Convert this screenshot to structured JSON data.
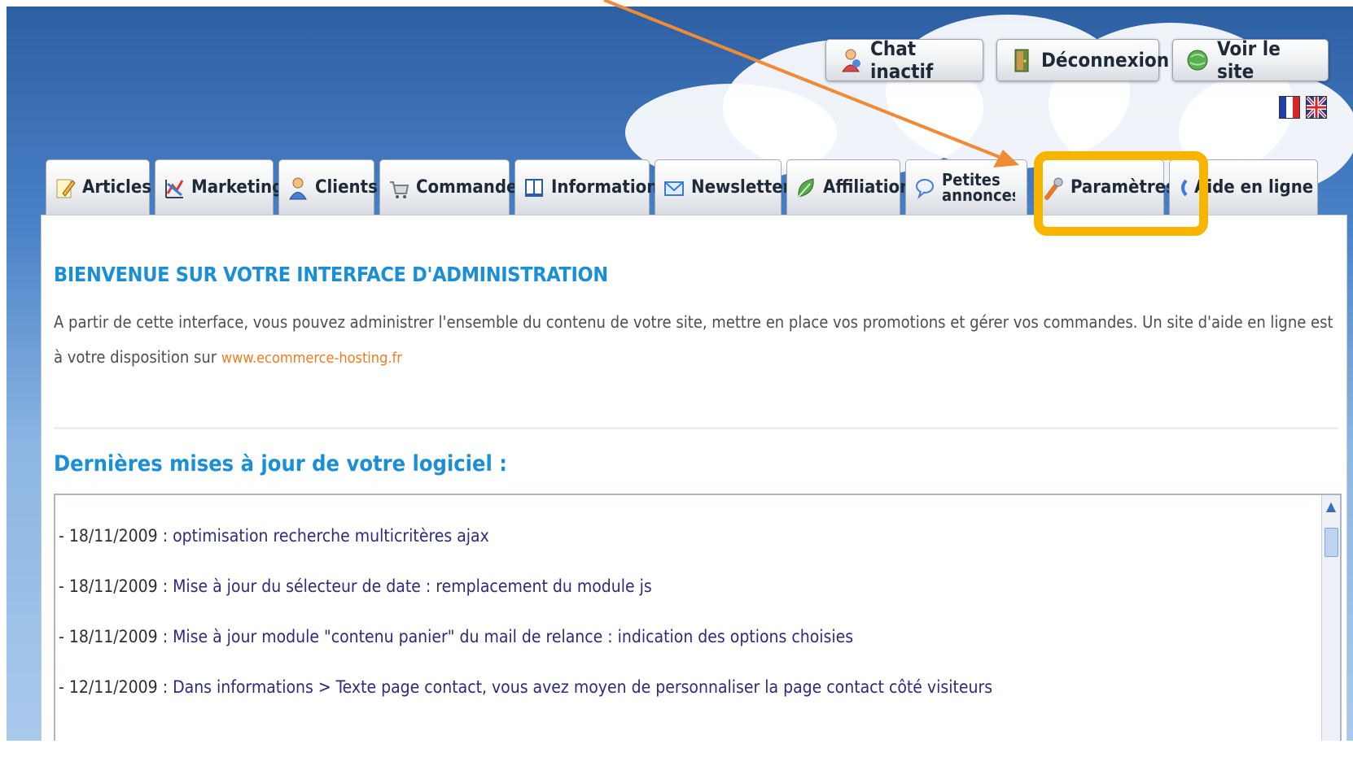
{
  "top_buttons": {
    "chat": "Chat inactif",
    "logout": "Déconnexion",
    "view_site": "Voir le site"
  },
  "tabs": [
    {
      "label": "Articles",
      "icon": "pencil-note-icon"
    },
    {
      "label": "Marketing",
      "icon": "chart-icon"
    },
    {
      "label": "Clients",
      "icon": "user-icon"
    },
    {
      "label": "Commandes",
      "icon": "cart-icon"
    },
    {
      "label": "Informations",
      "icon": "book-icon"
    },
    {
      "label": "Newsletter",
      "icon": "envelope-icon"
    },
    {
      "label": "Affiliation",
      "icon": "leaf-icon"
    },
    {
      "label": "Petites annonces",
      "icon": "speech-bubble-icon"
    },
    {
      "label": "Paramètres",
      "icon": "wrench-icon"
    },
    {
      "label": "Aide en ligne",
      "icon": "help-icon"
    }
  ],
  "main": {
    "welcome_title": "BIENVENUE SUR VOTRE INTERFACE D'ADMINISTRATION",
    "intro_text": "A partir de cette interface, vous pouvez administrer l'ensemble du contenu de votre site, mettre en place vos promotions et gérer vos commandes. Un site d'aide en ligne est à votre disposition sur ",
    "intro_link": "www.ecommerce-hosting.fr",
    "updates_title": "Dernières mises à jour de votre logiciel :",
    "updates": [
      {
        "date": "- 18/11/2009 :",
        "text": "optimisation recherche multicritères ajax"
      },
      {
        "date": "- 18/11/2009 :",
        "text": "Mise à jour du sélecteur de date : remplacement du module js"
      },
      {
        "date": "- 18/11/2009 :",
        "text": "Mise à jour module \"contenu panier\" du mail de relance : indication des options choisies"
      },
      {
        "date": "- 12/11/2009 :",
        "text": "Dans informations > Texte page contact, vous avez moyen de personnaliser la page contact côté visiteurs"
      }
    ]
  },
  "colors": {
    "title_blue": "#1a8fd6",
    "link_orange": "#ee7d23",
    "highlight": "#f7b500",
    "arrow": "#f08a35"
  }
}
